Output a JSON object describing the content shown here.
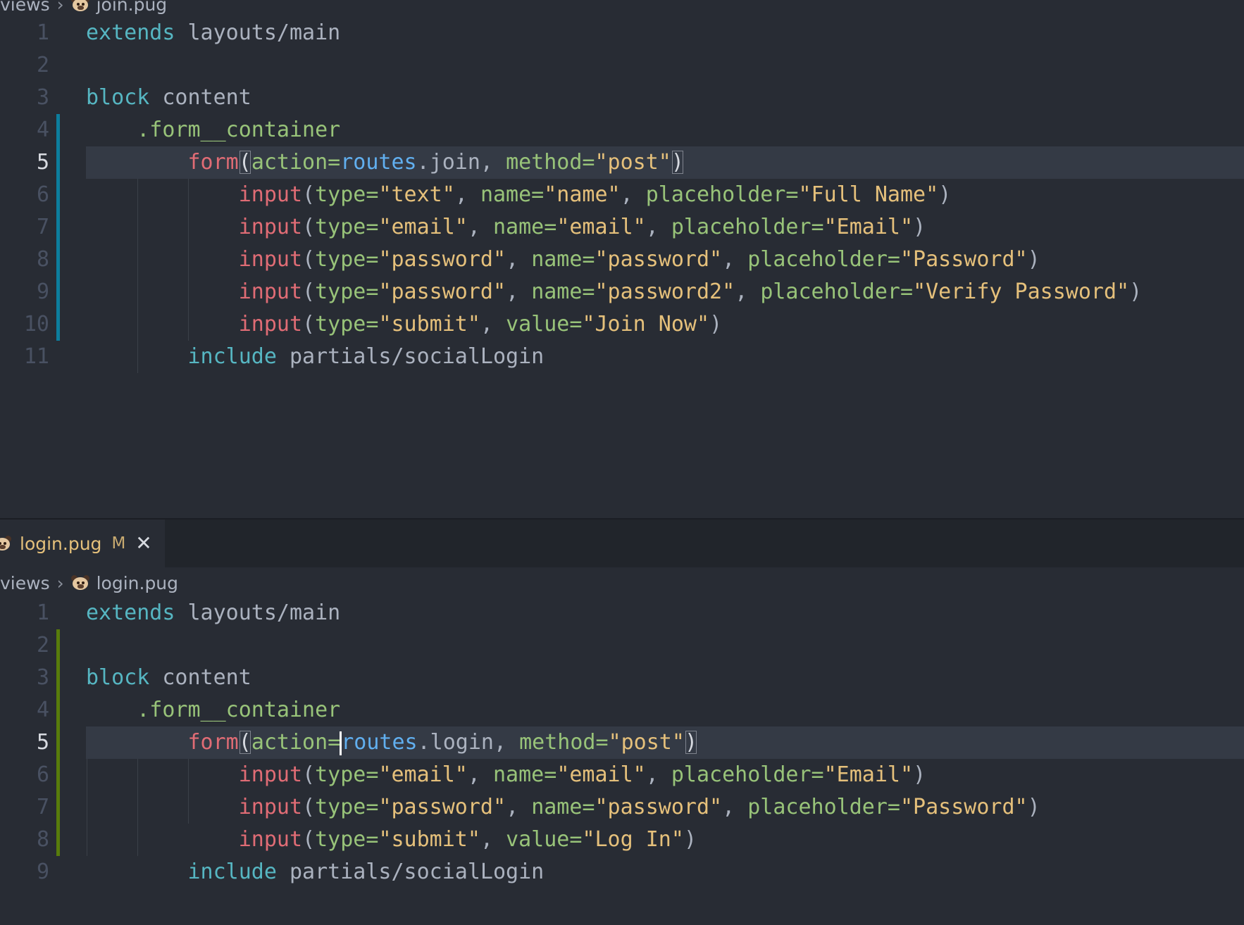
{
  "top_editor": {
    "breadcrumb": {
      "folder": "views",
      "file": "join.pug"
    },
    "lines": [
      {
        "n": "1",
        "parts": [
          [
            "kw",
            "extends"
          ],
          [
            "pl",
            " layouts/main"
          ]
        ]
      },
      {
        "n": "2",
        "parts": []
      },
      {
        "n": "3",
        "parts": [
          [
            "kw",
            "block"
          ],
          [
            "pl",
            " content"
          ]
        ]
      },
      {
        "n": "4",
        "parts": [
          [
            "pl",
            "    "
          ],
          [
            "cls",
            ".form__container"
          ]
        ]
      },
      {
        "n": "5",
        "active": true,
        "parts": [
          [
            "pl",
            "        "
          ],
          [
            "tag",
            "form"
          ],
          [
            "br",
            "("
          ],
          [
            "attr",
            "action="
          ],
          [
            "var",
            "routes"
          ],
          [
            "pl",
            ".join, "
          ],
          [
            "attr",
            "method="
          ],
          [
            "str",
            "\"post\""
          ],
          [
            "br",
            ")"
          ]
        ]
      },
      {
        "n": "6",
        "parts": [
          [
            "pl",
            "            "
          ],
          [
            "tag",
            "input"
          ],
          [
            "pl",
            "("
          ],
          [
            "attr",
            "type="
          ],
          [
            "str",
            "\"text\""
          ],
          [
            "pl",
            ", "
          ],
          [
            "attr",
            "name="
          ],
          [
            "str",
            "\"name\""
          ],
          [
            "pl",
            ", "
          ],
          [
            "attr",
            "placeholder="
          ],
          [
            "str",
            "\"Full Name\""
          ],
          [
            "pl",
            ")"
          ]
        ]
      },
      {
        "n": "7",
        "parts": [
          [
            "pl",
            "            "
          ],
          [
            "tag",
            "input"
          ],
          [
            "pl",
            "("
          ],
          [
            "attr",
            "type="
          ],
          [
            "str",
            "\"email\""
          ],
          [
            "pl",
            ", "
          ],
          [
            "attr",
            "name="
          ],
          [
            "str",
            "\"email\""
          ],
          [
            "pl",
            ", "
          ],
          [
            "attr",
            "placeholder="
          ],
          [
            "str",
            "\"Email\""
          ],
          [
            "pl",
            ")"
          ]
        ]
      },
      {
        "n": "8",
        "parts": [
          [
            "pl",
            "            "
          ],
          [
            "tag",
            "input"
          ],
          [
            "pl",
            "("
          ],
          [
            "attr",
            "type="
          ],
          [
            "str",
            "\"password\""
          ],
          [
            "pl",
            ", "
          ],
          [
            "attr",
            "name="
          ],
          [
            "str",
            "\"password\""
          ],
          [
            "pl",
            ", "
          ],
          [
            "attr",
            "placeholder="
          ],
          [
            "str",
            "\"Password\""
          ],
          [
            "pl",
            ")"
          ]
        ]
      },
      {
        "n": "9",
        "parts": [
          [
            "pl",
            "            "
          ],
          [
            "tag",
            "input"
          ],
          [
            "pl",
            "("
          ],
          [
            "attr",
            "type="
          ],
          [
            "str",
            "\"password\""
          ],
          [
            "pl",
            ", "
          ],
          [
            "attr",
            "name="
          ],
          [
            "str",
            "\"password2\""
          ],
          [
            "pl",
            ", "
          ],
          [
            "attr",
            "placeholder="
          ],
          [
            "str",
            "\"Verify Password\""
          ],
          [
            "pl",
            ")"
          ]
        ]
      },
      {
        "n": "10",
        "parts": [
          [
            "pl",
            "            "
          ],
          [
            "tag",
            "input"
          ],
          [
            "pl",
            "("
          ],
          [
            "attr",
            "type="
          ],
          [
            "str",
            "\"submit\""
          ],
          [
            "pl",
            ", "
          ],
          [
            "attr",
            "value="
          ],
          [
            "str",
            "\"Join Now\""
          ],
          [
            "pl",
            ")"
          ]
        ]
      },
      {
        "n": "11",
        "parts": [
          [
            "pl",
            "        "
          ],
          [
            "kw",
            "include"
          ],
          [
            "pl",
            " partials/socialLogin"
          ]
        ]
      }
    ]
  },
  "bottom_editor": {
    "tab": {
      "filename": "login.pug",
      "status": "M",
      "close": "✕"
    },
    "breadcrumb": {
      "folder": "views",
      "file": "login.pug"
    },
    "lines": [
      {
        "n": "1",
        "parts": [
          [
            "kw",
            "extends"
          ],
          [
            "pl",
            " layouts/main"
          ]
        ]
      },
      {
        "n": "2",
        "parts": []
      },
      {
        "n": "3",
        "parts": [
          [
            "kw",
            "block"
          ],
          [
            "pl",
            " content"
          ]
        ]
      },
      {
        "n": "4",
        "parts": [
          [
            "pl",
            "    "
          ],
          [
            "cls",
            ".form__container"
          ]
        ]
      },
      {
        "n": "5",
        "active": true,
        "parts": [
          [
            "pl",
            "        "
          ],
          [
            "tag",
            "form"
          ],
          [
            "br",
            "("
          ],
          [
            "attr",
            "action="
          ],
          [
            "cursor",
            ""
          ],
          [
            "var",
            "routes"
          ],
          [
            "pl",
            ".login, "
          ],
          [
            "attr",
            "method="
          ],
          [
            "str",
            "\"post\""
          ],
          [
            "br",
            ")"
          ]
        ]
      },
      {
        "n": "6",
        "parts": [
          [
            "pl",
            "            "
          ],
          [
            "tag",
            "input"
          ],
          [
            "pl",
            "("
          ],
          [
            "attr",
            "type="
          ],
          [
            "str",
            "\"email\""
          ],
          [
            "pl",
            ", "
          ],
          [
            "attr",
            "name="
          ],
          [
            "str",
            "\"email\""
          ],
          [
            "pl",
            ", "
          ],
          [
            "attr",
            "placeholder="
          ],
          [
            "str",
            "\"Email\""
          ],
          [
            "pl",
            ")"
          ]
        ]
      },
      {
        "n": "7",
        "parts": [
          [
            "pl",
            "            "
          ],
          [
            "tag",
            "input"
          ],
          [
            "pl",
            "("
          ],
          [
            "attr",
            "type="
          ],
          [
            "str",
            "\"password\""
          ],
          [
            "pl",
            ", "
          ],
          [
            "attr",
            "name="
          ],
          [
            "str",
            "\"password\""
          ],
          [
            "pl",
            ", "
          ],
          [
            "attr",
            "placeholder="
          ],
          [
            "str",
            "\"Password\""
          ],
          [
            "pl",
            ")"
          ]
        ]
      },
      {
        "n": "8",
        "parts": [
          [
            "pl",
            "            "
          ],
          [
            "tag",
            "input"
          ],
          [
            "pl",
            "("
          ],
          [
            "attr",
            "type="
          ],
          [
            "str",
            "\"submit\""
          ],
          [
            "pl",
            ", "
          ],
          [
            "attr",
            "value="
          ],
          [
            "str",
            "\"Log In\""
          ],
          [
            "pl",
            ")"
          ]
        ]
      },
      {
        "n": "9",
        "parts": [
          [
            "pl",
            "        "
          ],
          [
            "kw",
            "include"
          ],
          [
            "pl",
            " partials/socialLogin"
          ]
        ]
      }
    ]
  },
  "colors": {
    "background": "#282c34",
    "tabbar": "#21252b",
    "keyword": "#56b6c2",
    "tag": "#e06c75",
    "class": "#98c379",
    "string": "#e5c07b",
    "variable": "#61afef",
    "git_modified_bar": "#0c7d9d",
    "git_added_bar": "#587c0c"
  }
}
